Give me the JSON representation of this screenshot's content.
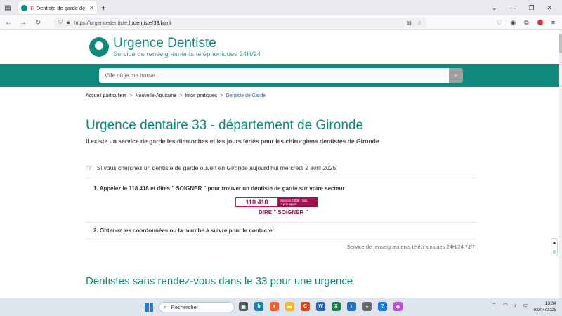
{
  "browser": {
    "tab_title": "Dentiste de garde de Giron",
    "url_host": "https://urgencedentiste.fr",
    "url_path": "/dentiste/33.html"
  },
  "site": {
    "brand": "Urgence Dentiste",
    "tagline": "Service de renseignements téléphoniques 24H/24",
    "search_placeholder": "Ville où je me trouve...",
    "accent_color": "#0e8a7c",
    "highlight_color": "#a0124f"
  },
  "breadcrumb": {
    "items": [
      "Accueil particuliers",
      "Nouvelle-Aquitaine",
      "Infos pratiques"
    ],
    "current": "Dentiste de Garde",
    "separator": ">"
  },
  "main": {
    "title": "Urgence dentaire 33 - département de Gironde",
    "subtitle": "Il existe un service de garde les dimanches et les jours fériés pour les chirurgiens dentistes de Gironde",
    "intro": "Si vous cherchez un dentiste de garde ouvert en Gironde aujourd'hui mercredi 2 avril 2025",
    "step1": "1.  Appelez le 118 418 et dites \" SOIGNER \" pour trouver un dentiste de garde sur votre secteur",
    "phone_number": "118 418",
    "price_line1": "Service 0,80€ / min",
    "price_line2": "+ prix appel",
    "say_text": "DIRE \" SOIGNER \"",
    "step2": "2.  Obtenez les coordonnées ou la marche à suivre pour le contacter",
    "service_note": "Service de renseignements téléphoniques 24H/24 7J/7",
    "section2_title": "Dentistes sans rendez-vous dans le 33 pour une urgence"
  },
  "taskbar": {
    "search_label": "Rechercher",
    "time": "13:34",
    "date": "02/04/2025"
  }
}
